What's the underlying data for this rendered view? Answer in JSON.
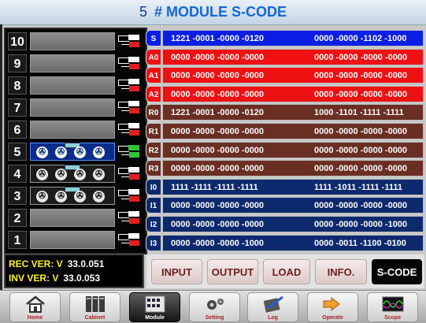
{
  "header": {
    "module_number": "5",
    "title": "# MODULE S-CODE"
  },
  "slots": [
    {
      "number": "10",
      "state": "empty"
    },
    {
      "number": "9",
      "state": "empty"
    },
    {
      "number": "8",
      "state": "empty"
    },
    {
      "number": "7",
      "state": "empty"
    },
    {
      "number": "6",
      "state": "empty"
    },
    {
      "number": "5",
      "state": "active"
    },
    {
      "number": "4",
      "state": "loaded"
    },
    {
      "number": "3",
      "state": "loaded"
    },
    {
      "number": "2",
      "state": "empty"
    },
    {
      "number": "1",
      "state": "empty"
    }
  ],
  "version": {
    "rec_label": "REC VER: V",
    "rec_value": "33.0.051",
    "inv_label": "INV VER: V",
    "inv_value": "33.0.053"
  },
  "registers": [
    {
      "label": "S",
      "v1": "1221 -0001 -0000 -0120",
      "v2": "0000 -0000 -1102 -1000",
      "color": "#0a1ee6"
    },
    {
      "label": "A0",
      "v1": "0000 -0000 -0000 -0000",
      "v2": "0000 -0000 -0000 -0000",
      "color": "#ef1111"
    },
    {
      "label": "A1",
      "v1": "0000 -0000 -0000 -0000",
      "v2": "0000 -0000 -0000 -0000",
      "color": "#ef1111"
    },
    {
      "label": "A2",
      "v1": "0000 -0000 -0000 -0000",
      "v2": "0000 -0000 -0000 -0000",
      "color": "#ef1111"
    },
    {
      "label": "R0",
      "v1": "1221 -0001 -0000 -0120",
      "v2": "1000 -1101 -1111 -1111",
      "color": "#6b2e23"
    },
    {
      "label": "R1",
      "v1": "0000 -0000 -0000 -0000",
      "v2": "0000 -0000 -0000 -0000",
      "color": "#6b2e23"
    },
    {
      "label": "R2",
      "v1": "0000 -0000 -0000 -0000",
      "v2": "0000 -0000 -0000 -0000",
      "color": "#6b2e23"
    },
    {
      "label": "R3",
      "v1": "0000 -0000 -0000 -0000",
      "v2": "0000 -0000 -0000 -0000",
      "color": "#6b2e23"
    },
    {
      "label": "I0",
      "v1": "1111 -1111 -1111 -1111",
      "v2": "1111 -1011 -1111 -1111",
      "color": "#0d2a6e"
    },
    {
      "label": "I1",
      "v1": "0000 -0000 -0000 -0000",
      "v2": "0000 -0000 -0000 -0000",
      "color": "#0d2a6e"
    },
    {
      "label": "I2",
      "v1": "0000 -0000 -0000 -0000",
      "v2": "0000 -0000 -0000 -1000",
      "color": "#0d2a6e"
    },
    {
      "label": "I3",
      "v1": "0000 -0000 -0000 -1000",
      "v2": "0000 -0011 -1100 -0100",
      "color": "#0d2a6e"
    }
  ],
  "tabs": [
    "INPUT",
    "OUTPUT",
    "LOAD",
    "INFO.",
    "S-CODE"
  ],
  "selected_tab": "S-CODE",
  "nav": [
    "Home",
    "Cabinet",
    "Module",
    "Setting",
    "Log",
    "Operate",
    "Scope"
  ],
  "selected_nav": "Module"
}
